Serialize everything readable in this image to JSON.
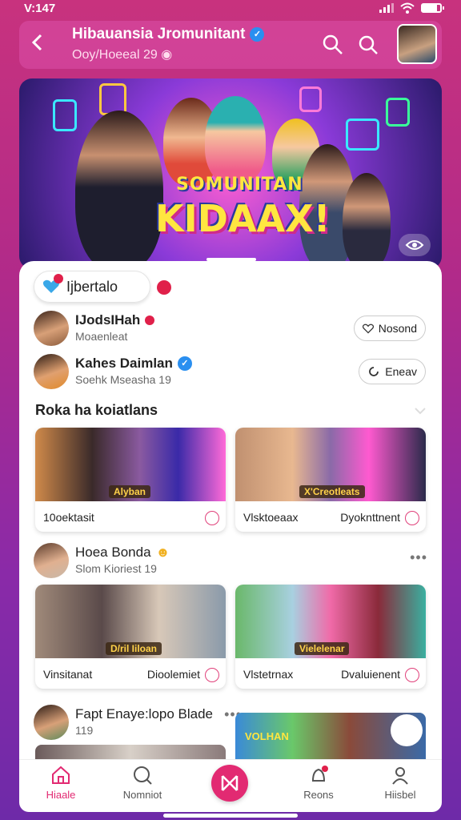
{
  "status_bar": {
    "time": "V:147"
  },
  "header": {
    "title": "Hibauansia Jromunitant",
    "subtitle": "Ooy/Hoeeal 29",
    "back_icon": "chevron-left-icon"
  },
  "hero": {
    "title_small": "SOMUNITAN",
    "title_large": "KIDAAX!"
  },
  "group_pill": {
    "label": "Ijbertalo"
  },
  "users": [
    {
      "name": "IJodsIHah",
      "sub": "Moaenleat",
      "action": "Nosond"
    },
    {
      "name": "Kahes Daimlan",
      "sub": "Soehk Mseasha 19",
      "action": "Eneav"
    }
  ],
  "section_title": "Roka ha koiatlans",
  "videos_row1": [
    {
      "tag": "Alyban",
      "left": "10oektasit",
      "right": ""
    },
    {
      "tag": "X'Creotleats",
      "left": "Vlsktoeaax",
      "right": "Dyoknttnent"
    }
  ],
  "post1": {
    "name": "Hoea Bonda",
    "sub": "Slom Kioriest 19"
  },
  "videos_row2": [
    {
      "tag": "D/ril Iiloan",
      "left": "Vinsitanat",
      "right": "Dioolemiet"
    },
    {
      "tag": "Vielelenar",
      "left": "Vlstetrnax",
      "right": "Dvaluienent"
    }
  ],
  "post2": {
    "name": "Fapt Enaye:lopo Blade",
    "sub": "119"
  },
  "video_row3_tag": "VOLHAN",
  "nav": [
    {
      "label": "Hiaale",
      "icon": "home-icon"
    },
    {
      "label": "Nomniot",
      "icon": "search-icon"
    },
    {
      "label": "",
      "icon": "create-icon"
    },
    {
      "label": "Reons",
      "icon": "notifications-icon"
    },
    {
      "label": "Hiisbel",
      "icon": "profile-icon"
    }
  ],
  "colors": {
    "accent": "#e22a72",
    "verify": "#2a8ff0"
  }
}
